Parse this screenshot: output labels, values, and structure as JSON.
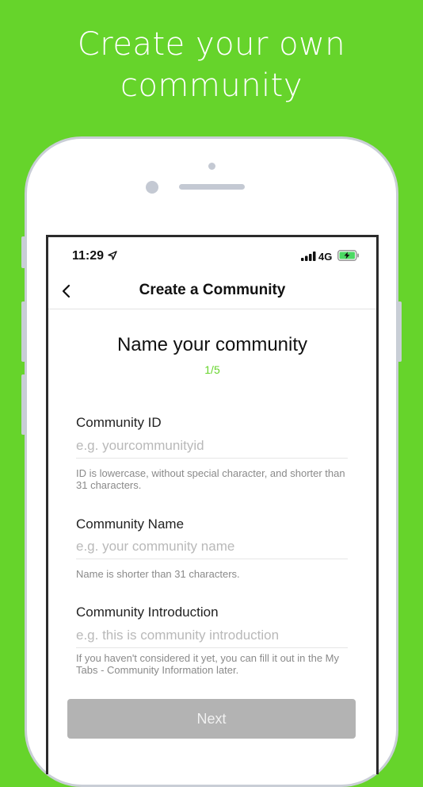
{
  "promo": {
    "headline_line1": "Create your own",
    "headline_line2": "community"
  },
  "status_bar": {
    "time": "11:29",
    "network": "4G"
  },
  "navbar": {
    "title": "Create a Community",
    "back_icon": "chevron-left-icon"
  },
  "form": {
    "heading": "Name your community",
    "step": "1/5",
    "fields": [
      {
        "label": "Community ID",
        "placeholder": "e.g. yourcommunityid",
        "value": "",
        "hint": "ID is lowercase, without special character, and shorter than 31 characters."
      },
      {
        "label": "Community Name",
        "placeholder": "e.g. your community name",
        "value": "",
        "hint": "Name is shorter than 31 characters."
      },
      {
        "label": "Community Introduction",
        "placeholder": "e.g. this is community introduction",
        "value": "",
        "hint": "If you haven't considered it yet, you can fill it out in the My Tabs - Community Information later."
      }
    ],
    "next_label": "Next"
  },
  "colors": {
    "brand_green": "#66d42b",
    "button_disabled": "#b3b3b3",
    "battery_green": "#4cd964"
  }
}
